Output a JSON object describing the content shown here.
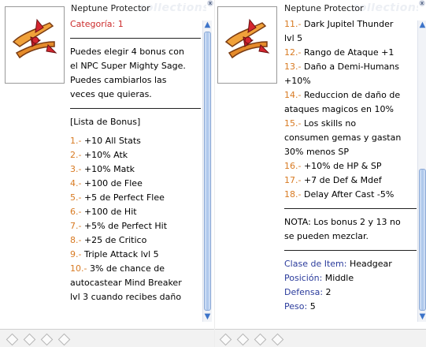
{
  "item_name": "Neptune Protector",
  "watermark": "collections",
  "colors": {
    "orange": "#d87a22",
    "red": "#cc2b2b",
    "blue": "#2a3b9c",
    "scroll_accent": "#3d74c9"
  },
  "left": {
    "category": "Categoría: 1",
    "description": [
      "Puedes elegir 4 bonus con",
      "el NPC Super Mighty Sage.",
      "Puedes cambiarlos las",
      "veces que quieras."
    ],
    "list_header": "[Lista de Bonus]",
    "bonus": [
      {
        "num": "1.-",
        "lines": [
          "+10 All Stats"
        ]
      },
      {
        "num": "2.-",
        "lines": [
          "+10% Atk"
        ]
      },
      {
        "num": "3.-",
        "lines": [
          "+10% Matk"
        ]
      },
      {
        "num": "4.-",
        "lines": [
          "+100 de Flee"
        ]
      },
      {
        "num": "5.-",
        "lines": [
          "+5 de Perfect Flee"
        ]
      },
      {
        "num": "6.-",
        "lines": [
          "+100 de Hit"
        ]
      },
      {
        "num": "7.-",
        "lines": [
          "+5% de Perfect Hit"
        ]
      },
      {
        "num": "8.-",
        "lines": [
          "+25 de Critico"
        ]
      },
      {
        "num": "9.-",
        "lines": [
          "Triple Attack lvl 5"
        ]
      },
      {
        "num": "10.-",
        "lines": [
          "3% de chance de",
          "autocastear Mind Breaker",
          "lvl 3 cuando recibes daño"
        ]
      }
    ]
  },
  "right": {
    "bonus": [
      {
        "num": "11.-",
        "lines": [
          "Dark Jupitel Thunder",
          "lvl 5"
        ]
      },
      {
        "num": "12.-",
        "lines": [
          "Rango de Ataque +1"
        ]
      },
      {
        "num": "13.-",
        "lines": [
          "Daño a Demi-Humans",
          "+10%"
        ]
      },
      {
        "num": "14.-",
        "lines": [
          "Reduccion de daño de",
          "ataques magicos en 10%"
        ]
      },
      {
        "num": "15.-",
        "lines": [
          "Los skills no",
          "consumen gemas y gastan",
          "30% menos SP"
        ]
      },
      {
        "num": "16.-",
        "lines": [
          "+10% de HP & SP"
        ]
      },
      {
        "num": "17.-",
        "lines": [
          "+7 de Def & Mdef"
        ]
      },
      {
        "num": "18.-",
        "lines": [
          "Delay After Cast -5%"
        ]
      }
    ],
    "note": [
      "NOTA: Los bonus 2 y 13 no",
      "se pueden mezclar."
    ],
    "properties": [
      {
        "label": "Clase de Item:",
        "value": "Headgear"
      },
      {
        "label": "Posición:",
        "value": "Middle"
      },
      {
        "label": "Defensa:",
        "value": "2"
      },
      {
        "label": "Peso:",
        "value": "5"
      }
    ]
  }
}
